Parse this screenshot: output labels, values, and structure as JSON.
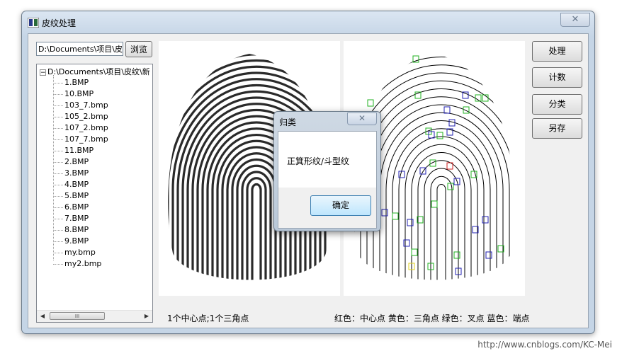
{
  "window": {
    "title": "皮纹处理",
    "close_label": "✕"
  },
  "toolbar": {
    "path_value": "D:\\Documents\\项目\\皮纹",
    "browse_label": "浏览"
  },
  "tree": {
    "root_label": "D:\\Documents\\项目\\皮纹\\新",
    "expander": "−",
    "items": [
      "1.BMP",
      "10.BMP",
      "103_7.bmp",
      "105_2.bmp",
      "107_2.bmp",
      "107_7.bmp",
      "11.BMP",
      "2.BMP",
      "3.BMP",
      "4.BMP",
      "5.BMP",
      "6.BMP",
      "7.BMP",
      "8.BMP",
      "9.BMP",
      "my.bmp",
      "my2.bmp"
    ],
    "scroll_thumb": "III",
    "scroll_left": "◀",
    "scroll_right": "▶"
  },
  "buttons": {
    "process": "处理",
    "count": "计数",
    "classify": "分类",
    "save_as": "另存"
  },
  "status": {
    "left": "1个中心点;1个三角点",
    "legend": "红色：中心点 黄色：三角点  绿色：叉点   蓝色：端点"
  },
  "dialog": {
    "title": "归类",
    "close_label": "✕",
    "message": "正箕形纹/斗型纹",
    "ok_label": "确定"
  },
  "watermark": "http://www.cnblogs.com/KC-Mei",
  "colors": {
    "center": "#d02020",
    "delta": "#e0d020",
    "bifurcation": "#20b020",
    "ending": "#2020b0"
  }
}
